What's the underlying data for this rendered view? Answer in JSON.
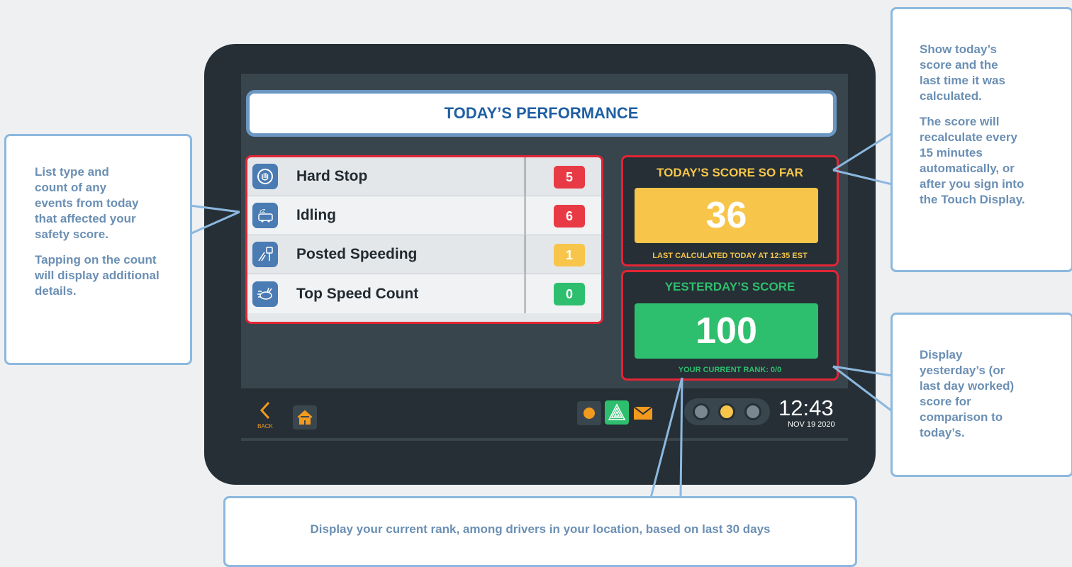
{
  "title": "TODAY’S PERFORMANCE",
  "events": [
    {
      "label": "Hard Stop",
      "count": "5",
      "color": "#e83a45",
      "icon": "hand-stop-icon"
    },
    {
      "label": "Idling",
      "count": "6",
      "color": "#e83a45",
      "icon": "idling-bus-icon"
    },
    {
      "label": "Posted Speeding",
      "count": "1",
      "color": "#f7c54a",
      "icon": "speed-sign-icon"
    },
    {
      "label": "Top Speed Count",
      "count": "0",
      "color": "#2ebf6e",
      "icon": "rabbit-icon"
    }
  ],
  "today_score": {
    "title": "TODAY’S SCORE SO FAR",
    "value": "36",
    "note": "LAST CALCULATED TODAY AT 12:35 EST",
    "color": "#f7c54a"
  },
  "yesterday_score": {
    "title": "YESTERDAY’S SCORE",
    "value": "100",
    "note": "YOUR CURRENT RANK:  0/0",
    "color": "#2ebf6e"
  },
  "bottom_bar": {
    "back_label": "BACK",
    "time": "12:43",
    "date": "NOV 19 2020"
  },
  "callouts": {
    "events": [
      "List type and count of any events from today that affected your safety score.",
      "Tapping on the count will display additional details."
    ],
    "today": [
      "Show today’s score and the last time it was calculated.",
      "The score will recalculate every 15 minutes automatically, or after you sign into the Touch Display."
    ],
    "yesterday": [
      "Display yesterday’s (or last day worked) score for comparison to today’s."
    ],
    "rank": "Display your current rank, among drivers in your location, based on last 30 days"
  },
  "colors": {
    "accent_orange": "#f29a1e",
    "frame": "#252f35",
    "highlight_red": "#e22535"
  }
}
